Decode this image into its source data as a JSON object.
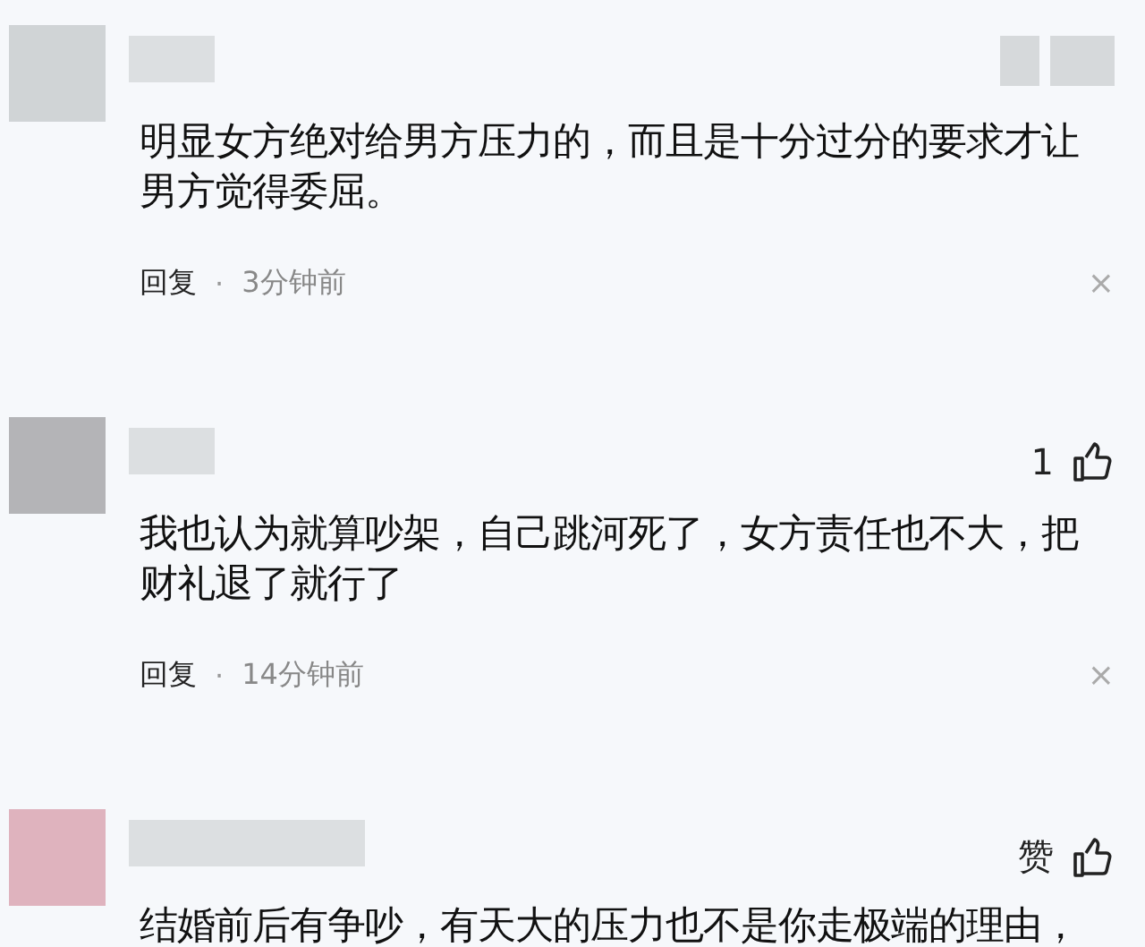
{
  "comments": [
    {
      "avatar": {
        "color": "#d0d4d6"
      },
      "author": {
        "kind": "blurred"
      },
      "reaction": {
        "kind": "blurred"
      },
      "text": "明显女方绝对给男方压力的，而且是十分过分的要求才让男方觉得委屈。",
      "reply": "回复",
      "separator": "·",
      "time": "3分钟前",
      "close": "×"
    },
    {
      "avatar": {
        "color": "#b4b4b7"
      },
      "author": {
        "kind": "blurred"
      },
      "reaction": {
        "kind": "likes",
        "label": "1"
      },
      "text": "我也认为就算吵架，自己跳河死了，女方责任也不大，把财礼退了就行了",
      "reply": "回复",
      "separator": "·",
      "time": "14分钟前",
      "close": "×"
    },
    {
      "avatar": {
        "color": "#dfb3be"
      },
      "author": {
        "kind": "blurred"
      },
      "reaction": {
        "kind": "likes",
        "label": "赞"
      },
      "text": "结婚前后有争吵，有天大的压力也不是你走极端的理由，"
    }
  ]
}
